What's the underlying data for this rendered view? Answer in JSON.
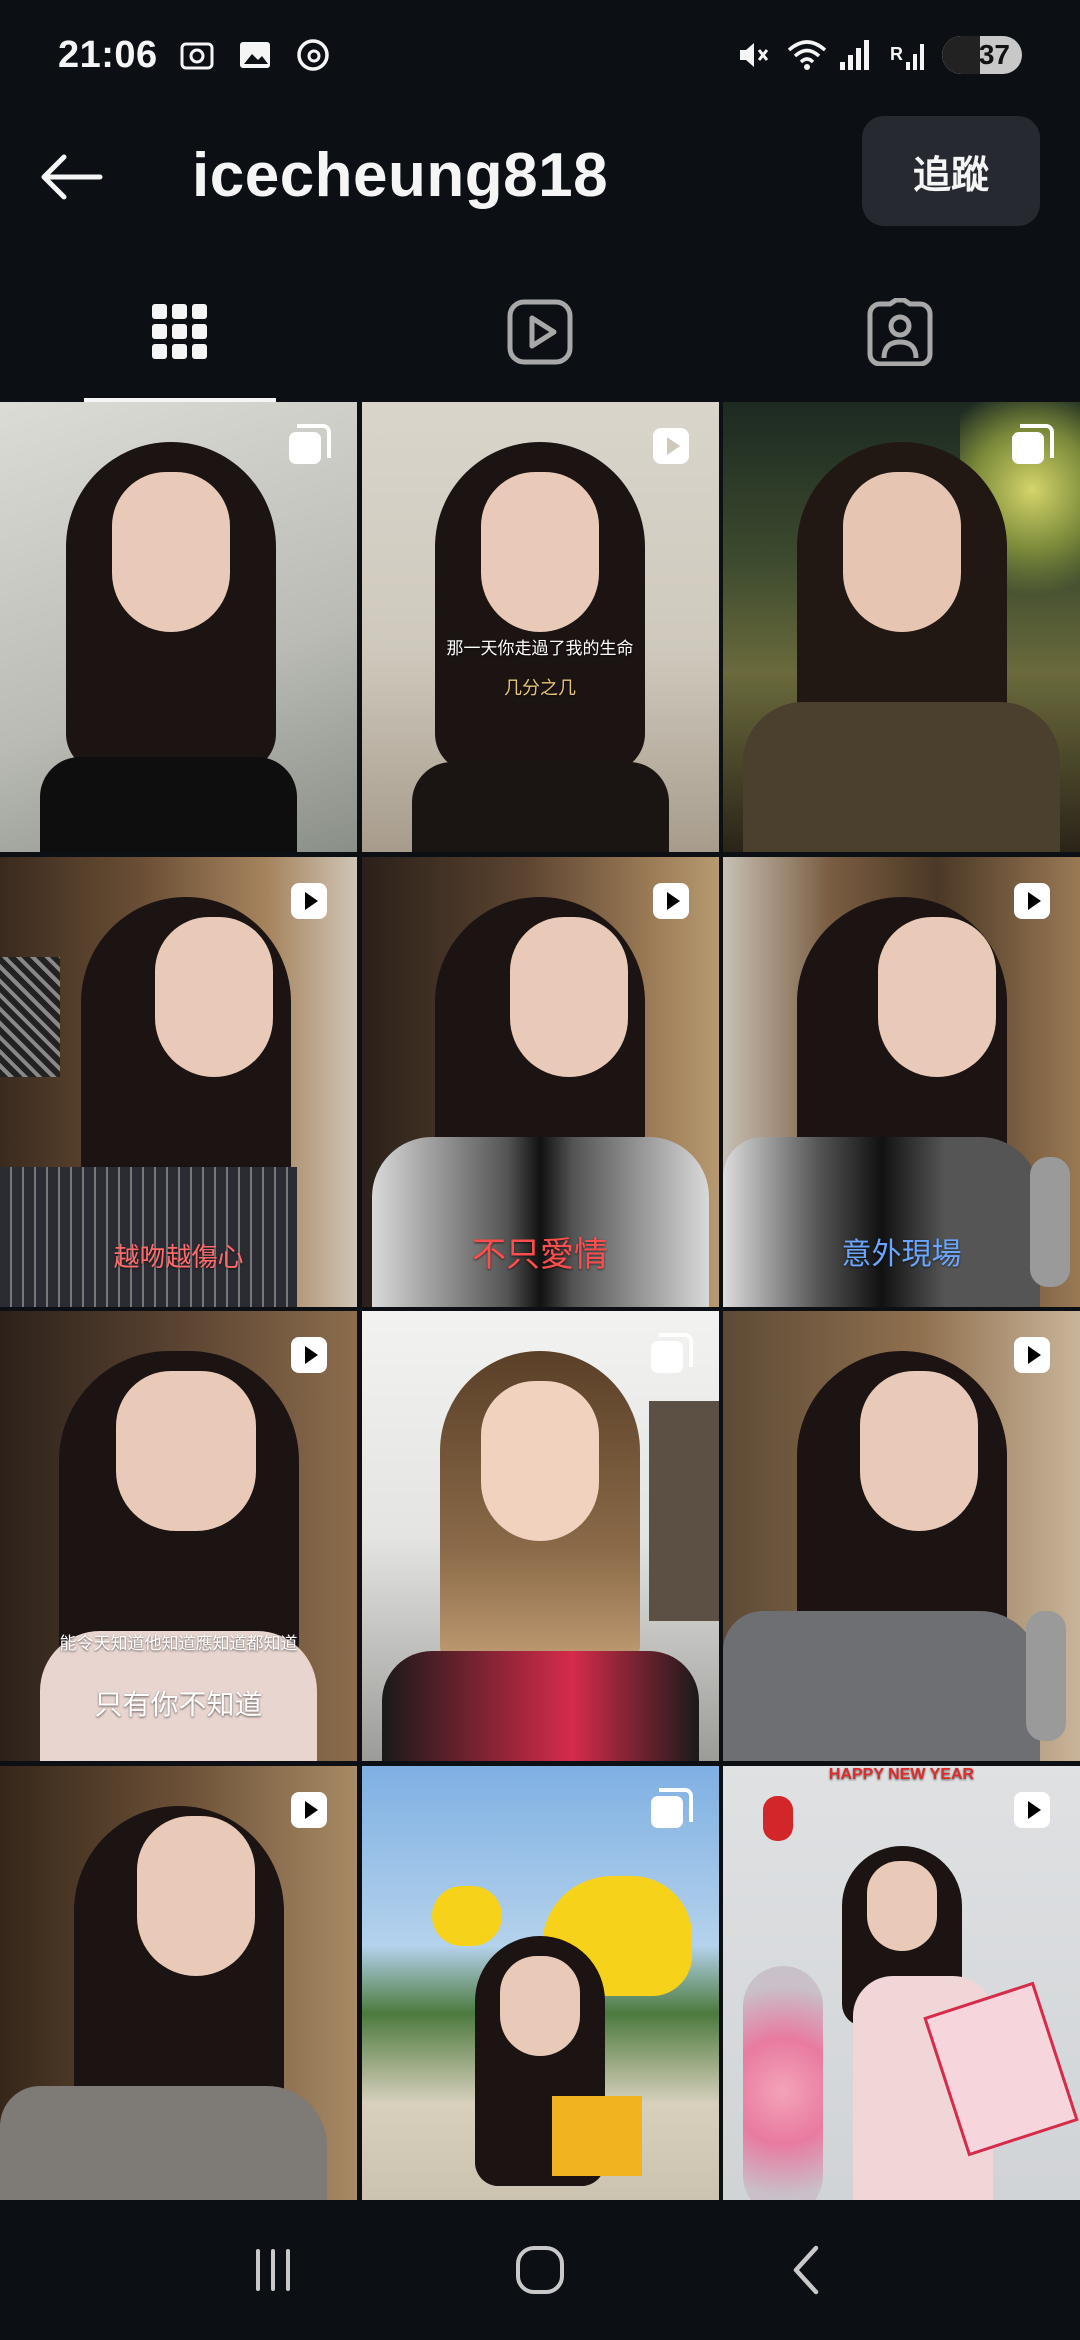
{
  "status_bar": {
    "time": "21:06",
    "battery": "37",
    "icons": [
      "screenshot-icon",
      "gallery-icon",
      "threads-icon",
      "mute-icon",
      "wifi-icon",
      "signal-icon",
      "signal-r-icon"
    ]
  },
  "header": {
    "username": "icecheung818",
    "follow_label": "追蹤"
  },
  "tabs": [
    {
      "name": "posts-grid-icon",
      "active": true
    },
    {
      "name": "reels-icon",
      "active": false
    },
    {
      "name": "tagged-icon",
      "active": false
    }
  ],
  "posts": [
    {
      "type": "carousel",
      "caption1": "",
      "caption2": ""
    },
    {
      "type": "clip",
      "caption1": "那一天你走過了我的生命",
      "caption2": "几分之几"
    },
    {
      "type": "carousel",
      "caption1": "",
      "caption2": ""
    },
    {
      "type": "reel",
      "caption1": "越吻越傷心",
      "caption2": ""
    },
    {
      "type": "reel",
      "caption1": "不只愛情",
      "caption2": ""
    },
    {
      "type": "reel",
      "caption1": "意外現場",
      "caption2": ""
    },
    {
      "type": "reel",
      "caption1": "能令天知道他知道應知道都知道",
      "caption2": "只有你不知道"
    },
    {
      "type": "carousel",
      "caption1": "",
      "caption2": ""
    },
    {
      "type": "reel",
      "caption1": "",
      "caption2": ""
    },
    {
      "type": "reel",
      "caption1": "",
      "caption2": ""
    },
    {
      "type": "carousel",
      "caption1": "",
      "caption2": ""
    },
    {
      "type": "reel",
      "caption1": "HAPPY NEW YEAR",
      "caption2": ""
    }
  ],
  "nav": [
    "recents-icon",
    "home-icon",
    "back-icon"
  ],
  "colors": {
    "background": "#0c1014",
    "text": "#f5f5f5",
    "follow_button": "#262a30"
  }
}
